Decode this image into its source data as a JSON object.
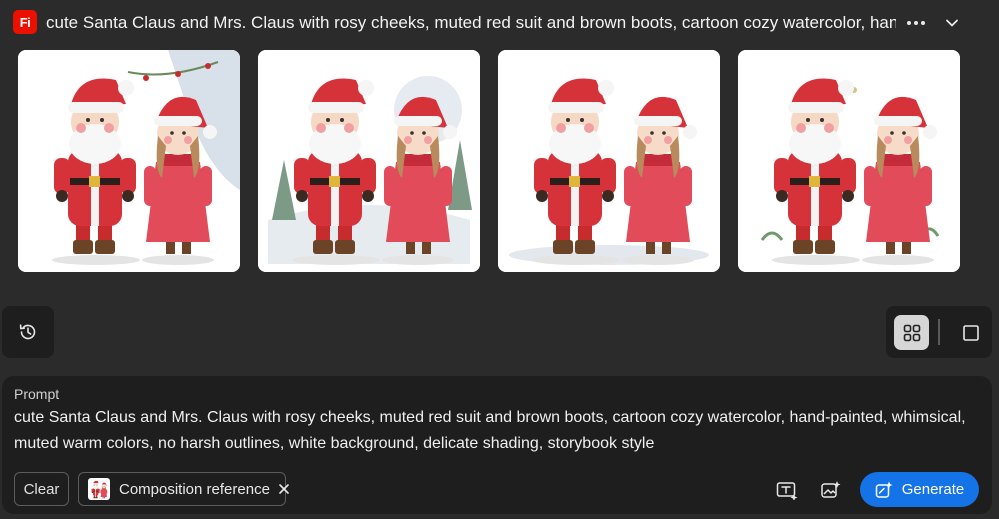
{
  "header": {
    "app_badge": "Fi",
    "title": "cute Santa Claus and Mrs. Claus with rosy cheeks, muted red suit and brown boots, cartoon cozy watercolor, hand-painted, whimsical, muted warm colors, no harsh outlines, white background, delicate shading, storybook style",
    "more_icon": "more-horizontal-icon",
    "collapse_icon": "chevron-down-icon"
  },
  "results": {
    "images": [
      {
        "name": "result-image-1"
      },
      {
        "name": "result-image-2"
      },
      {
        "name": "result-image-3"
      },
      {
        "name": "result-image-4"
      }
    ]
  },
  "history": {
    "icon": "history-icon"
  },
  "view_toggle": {
    "selected": "grid",
    "options": [
      "grid",
      "single"
    ]
  },
  "prompt": {
    "label": "Prompt",
    "text": "cute Santa Claus and Mrs. Claus with rosy cheeks, muted red suit and brown boots, cartoon cozy watercolor, hand-painted, whimsical, muted warm colors, no harsh outlines, white background, delicate shading, storybook style"
  },
  "toolbar": {
    "clear_label": "Clear",
    "composition_reference_label": "Composition reference",
    "generate_label": "Generate"
  },
  "colors": {
    "background": "#2b2b2b",
    "panel": "#1e1e1e",
    "accent": "#1473e6",
    "app_badge": "#eb1000"
  }
}
